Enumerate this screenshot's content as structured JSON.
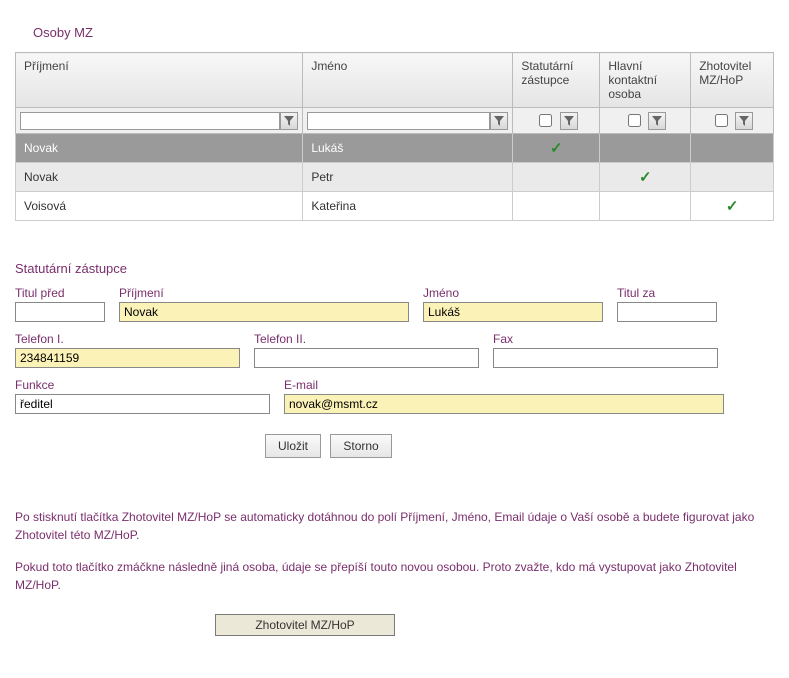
{
  "title": "Osoby MZ",
  "table": {
    "headers": {
      "surname": "Příjmení",
      "firstname": "Jméno",
      "statutory": "Statutární zástupce",
      "contact": "Hlavní kontaktní osoba",
      "zhotovitel": "Zhotovitel MZ/HoP"
    },
    "rows": [
      {
        "surname": "Novak",
        "firstname": "Lukáš",
        "statutory": true,
        "contact": false,
        "zhotovitel": false,
        "selected": true
      },
      {
        "surname": "Novak",
        "firstname": "Petr",
        "statutory": false,
        "contact": true,
        "zhotovitel": false,
        "selected": false
      },
      {
        "surname": "Voisová",
        "firstname": "Kateřina",
        "statutory": false,
        "contact": false,
        "zhotovitel": true,
        "selected": false
      }
    ]
  },
  "form": {
    "heading": "Statutární zástupce",
    "labels": {
      "title_before": "Titul před",
      "surname": "Příjmení",
      "firstname": "Jméno",
      "title_after": "Titul za",
      "phone1": "Telefon I.",
      "phone2": "Telefon II.",
      "fax": "Fax",
      "role": "Funkce",
      "email": "E-mail"
    },
    "values": {
      "title_before": "",
      "surname": "Novak",
      "firstname": "Lukáš",
      "title_after": "",
      "phone1": "234841159",
      "phone2": "",
      "fax": "",
      "role": "ředitel",
      "email": "novak@msmt.cz"
    },
    "buttons": {
      "save": "Uložit",
      "cancel": "Storno"
    }
  },
  "info": {
    "p1": "Po stisknutí tlačítka Zhotovitel MZ/HoP se automaticky dotáhnou do polí Příjmení, Jméno, Email údaje o Vaší osobě a budete figurovat jako Zhotovitel této MZ/HoP.",
    "p2": "Pokud toto tlačítko zmáčkne následně jiná osoba, údaje se přepíší touto novou osobou. Proto zvažte, kdo má vystupovat jako Zhotovitel MZ/HoP."
  },
  "zhotovitel_button": "Zhotovitel MZ/HoP"
}
